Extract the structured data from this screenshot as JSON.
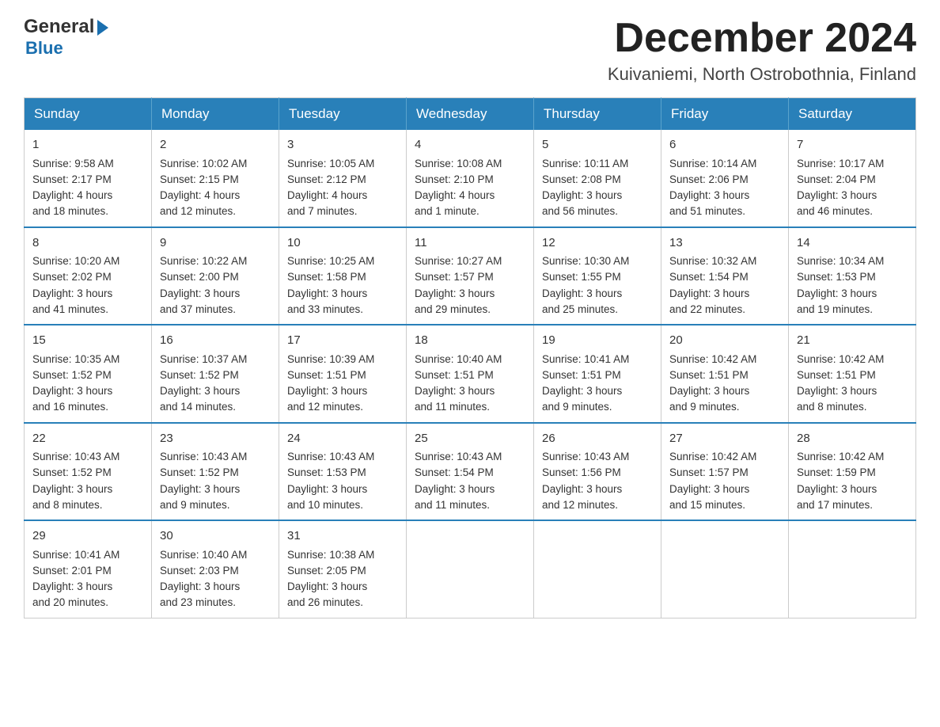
{
  "header": {
    "logo_general": "General",
    "logo_blue": "Blue",
    "month_title": "December 2024",
    "location": "Kuivaniemi, North Ostrobothnia, Finland"
  },
  "weekdays": [
    "Sunday",
    "Monday",
    "Tuesday",
    "Wednesday",
    "Thursday",
    "Friday",
    "Saturday"
  ],
  "weeks": [
    [
      {
        "day": "1",
        "sunrise": "Sunrise: 9:58 AM",
        "sunset": "Sunset: 2:17 PM",
        "daylight": "Daylight: 4 hours",
        "daylight2": "and 18 minutes."
      },
      {
        "day": "2",
        "sunrise": "Sunrise: 10:02 AM",
        "sunset": "Sunset: 2:15 PM",
        "daylight": "Daylight: 4 hours",
        "daylight2": "and 12 minutes."
      },
      {
        "day": "3",
        "sunrise": "Sunrise: 10:05 AM",
        "sunset": "Sunset: 2:12 PM",
        "daylight": "Daylight: 4 hours",
        "daylight2": "and 7 minutes."
      },
      {
        "day": "4",
        "sunrise": "Sunrise: 10:08 AM",
        "sunset": "Sunset: 2:10 PM",
        "daylight": "Daylight: 4 hours",
        "daylight2": "and 1 minute."
      },
      {
        "day": "5",
        "sunrise": "Sunrise: 10:11 AM",
        "sunset": "Sunset: 2:08 PM",
        "daylight": "Daylight: 3 hours",
        "daylight2": "and 56 minutes."
      },
      {
        "day": "6",
        "sunrise": "Sunrise: 10:14 AM",
        "sunset": "Sunset: 2:06 PM",
        "daylight": "Daylight: 3 hours",
        "daylight2": "and 51 minutes."
      },
      {
        "day": "7",
        "sunrise": "Sunrise: 10:17 AM",
        "sunset": "Sunset: 2:04 PM",
        "daylight": "Daylight: 3 hours",
        "daylight2": "and 46 minutes."
      }
    ],
    [
      {
        "day": "8",
        "sunrise": "Sunrise: 10:20 AM",
        "sunset": "Sunset: 2:02 PM",
        "daylight": "Daylight: 3 hours",
        "daylight2": "and 41 minutes."
      },
      {
        "day": "9",
        "sunrise": "Sunrise: 10:22 AM",
        "sunset": "Sunset: 2:00 PM",
        "daylight": "Daylight: 3 hours",
        "daylight2": "and 37 minutes."
      },
      {
        "day": "10",
        "sunrise": "Sunrise: 10:25 AM",
        "sunset": "Sunset: 1:58 PM",
        "daylight": "Daylight: 3 hours",
        "daylight2": "and 33 minutes."
      },
      {
        "day": "11",
        "sunrise": "Sunrise: 10:27 AM",
        "sunset": "Sunset: 1:57 PM",
        "daylight": "Daylight: 3 hours",
        "daylight2": "and 29 minutes."
      },
      {
        "day": "12",
        "sunrise": "Sunrise: 10:30 AM",
        "sunset": "Sunset: 1:55 PM",
        "daylight": "Daylight: 3 hours",
        "daylight2": "and 25 minutes."
      },
      {
        "day": "13",
        "sunrise": "Sunrise: 10:32 AM",
        "sunset": "Sunset: 1:54 PM",
        "daylight": "Daylight: 3 hours",
        "daylight2": "and 22 minutes."
      },
      {
        "day": "14",
        "sunrise": "Sunrise: 10:34 AM",
        "sunset": "Sunset: 1:53 PM",
        "daylight": "Daylight: 3 hours",
        "daylight2": "and 19 minutes."
      }
    ],
    [
      {
        "day": "15",
        "sunrise": "Sunrise: 10:35 AM",
        "sunset": "Sunset: 1:52 PM",
        "daylight": "Daylight: 3 hours",
        "daylight2": "and 16 minutes."
      },
      {
        "day": "16",
        "sunrise": "Sunrise: 10:37 AM",
        "sunset": "Sunset: 1:52 PM",
        "daylight": "Daylight: 3 hours",
        "daylight2": "and 14 minutes."
      },
      {
        "day": "17",
        "sunrise": "Sunrise: 10:39 AM",
        "sunset": "Sunset: 1:51 PM",
        "daylight": "Daylight: 3 hours",
        "daylight2": "and 12 minutes."
      },
      {
        "day": "18",
        "sunrise": "Sunrise: 10:40 AM",
        "sunset": "Sunset: 1:51 PM",
        "daylight": "Daylight: 3 hours",
        "daylight2": "and 11 minutes."
      },
      {
        "day": "19",
        "sunrise": "Sunrise: 10:41 AM",
        "sunset": "Sunset: 1:51 PM",
        "daylight": "Daylight: 3 hours",
        "daylight2": "and 9 minutes."
      },
      {
        "day": "20",
        "sunrise": "Sunrise: 10:42 AM",
        "sunset": "Sunset: 1:51 PM",
        "daylight": "Daylight: 3 hours",
        "daylight2": "and 9 minutes."
      },
      {
        "day": "21",
        "sunrise": "Sunrise: 10:42 AM",
        "sunset": "Sunset: 1:51 PM",
        "daylight": "Daylight: 3 hours",
        "daylight2": "and 8 minutes."
      }
    ],
    [
      {
        "day": "22",
        "sunrise": "Sunrise: 10:43 AM",
        "sunset": "Sunset: 1:52 PM",
        "daylight": "Daylight: 3 hours",
        "daylight2": "and 8 minutes."
      },
      {
        "day": "23",
        "sunrise": "Sunrise: 10:43 AM",
        "sunset": "Sunset: 1:52 PM",
        "daylight": "Daylight: 3 hours",
        "daylight2": "and 9 minutes."
      },
      {
        "day": "24",
        "sunrise": "Sunrise: 10:43 AM",
        "sunset": "Sunset: 1:53 PM",
        "daylight": "Daylight: 3 hours",
        "daylight2": "and 10 minutes."
      },
      {
        "day": "25",
        "sunrise": "Sunrise: 10:43 AM",
        "sunset": "Sunset: 1:54 PM",
        "daylight": "Daylight: 3 hours",
        "daylight2": "and 11 minutes."
      },
      {
        "day": "26",
        "sunrise": "Sunrise: 10:43 AM",
        "sunset": "Sunset: 1:56 PM",
        "daylight": "Daylight: 3 hours",
        "daylight2": "and 12 minutes."
      },
      {
        "day": "27",
        "sunrise": "Sunrise: 10:42 AM",
        "sunset": "Sunset: 1:57 PM",
        "daylight": "Daylight: 3 hours",
        "daylight2": "and 15 minutes."
      },
      {
        "day": "28",
        "sunrise": "Sunrise: 10:42 AM",
        "sunset": "Sunset: 1:59 PM",
        "daylight": "Daylight: 3 hours",
        "daylight2": "and 17 minutes."
      }
    ],
    [
      {
        "day": "29",
        "sunrise": "Sunrise: 10:41 AM",
        "sunset": "Sunset: 2:01 PM",
        "daylight": "Daylight: 3 hours",
        "daylight2": "and 20 minutes."
      },
      {
        "day": "30",
        "sunrise": "Sunrise: 10:40 AM",
        "sunset": "Sunset: 2:03 PM",
        "daylight": "Daylight: 3 hours",
        "daylight2": "and 23 minutes."
      },
      {
        "day": "31",
        "sunrise": "Sunrise: 10:38 AM",
        "sunset": "Sunset: 2:05 PM",
        "daylight": "Daylight: 3 hours",
        "daylight2": "and 26 minutes."
      },
      null,
      null,
      null,
      null
    ]
  ]
}
